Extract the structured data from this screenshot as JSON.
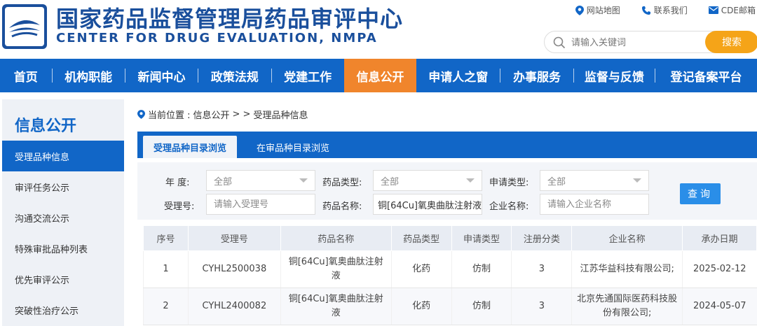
{
  "header": {
    "title_cn": "国家药品监督管理局药品审评中心",
    "title_en": "CENTER FOR DRUG EVALUATION, NMPA",
    "brand_color": "#1a4f9c",
    "top_links": [
      {
        "label": "网站地图",
        "icon": "location-pin-icon"
      },
      {
        "label": "联系我们",
        "icon": "phone-icon"
      },
      {
        "label": "CDE邮箱",
        "icon": "mail-icon"
      }
    ],
    "search": {
      "placeholder": "请输入关键词",
      "button_label": "搜索"
    }
  },
  "nav": {
    "items": [
      {
        "label": "首页",
        "active": false
      },
      {
        "label": "机构职能",
        "active": false
      },
      {
        "label": "新闻中心",
        "active": false
      },
      {
        "label": "政策法规",
        "active": false
      },
      {
        "label": "党建工作",
        "active": false
      },
      {
        "label": "信息公开",
        "active": true
      },
      {
        "label": "申请人之窗",
        "active": false
      },
      {
        "label": "办事服务",
        "active": false
      },
      {
        "label": "监督与反馈",
        "active": false
      },
      {
        "label": "登记备案平台",
        "active": false
      }
    ],
    "bg_color": "#1166c7",
    "active_color": "#f0852c"
  },
  "sidebar": {
    "title": "信息公开",
    "items": [
      {
        "label": "受理品种信息",
        "active": true
      },
      {
        "label": "审评任务公示",
        "active": false
      },
      {
        "label": "沟通交流公示",
        "active": false
      },
      {
        "label": "特殊审批品种列表",
        "active": false
      },
      {
        "label": "优先审评公示",
        "active": false
      },
      {
        "label": "突破性治疗公示",
        "active": false
      }
    ]
  },
  "breadcrumb": {
    "prefix": "当前位置 :",
    "path": "信息公开",
    "sep": "> >",
    "current": "受理品种信息"
  },
  "tabs": [
    {
      "label": "受理品种目录浏览",
      "active": true
    },
    {
      "label": "在审品种目录浏览",
      "active": false
    }
  ],
  "filters": {
    "year": {
      "label": "年    度:",
      "value": "全部"
    },
    "drug_type": {
      "label": "药品类型:",
      "value": "全部"
    },
    "apply_type": {
      "label": "申请类型:",
      "value": "全部"
    },
    "accept_no": {
      "label": "受理号:",
      "placeholder": "请输入受理号"
    },
    "drug_name": {
      "label": "药品名称:",
      "value": "铜[64Cu]氧奥曲肽注射液"
    },
    "company": {
      "label": "企业名称:",
      "placeholder": "请输入企业名称"
    },
    "query_label": "查询"
  },
  "table": {
    "columns": [
      "序号",
      "受理号",
      "药品名称",
      "药品类型",
      "申请类型",
      "注册分类",
      "企业名称",
      "承办日期"
    ],
    "rows": [
      [
        "1",
        "CYHL2500038",
        "铜[64Cu]氧奥曲肽注射液",
        "化药",
        "仿制",
        "3",
        "江苏华益科技有限公司;",
        "2025-02-12"
      ],
      [
        "2",
        "CYHL2400082",
        "铜[64Cu]氧奥曲肽注射液",
        "化药",
        "仿制",
        "3",
        "北京先通国际医药科技股份有限公司;",
        "2024-05-07"
      ]
    ]
  }
}
